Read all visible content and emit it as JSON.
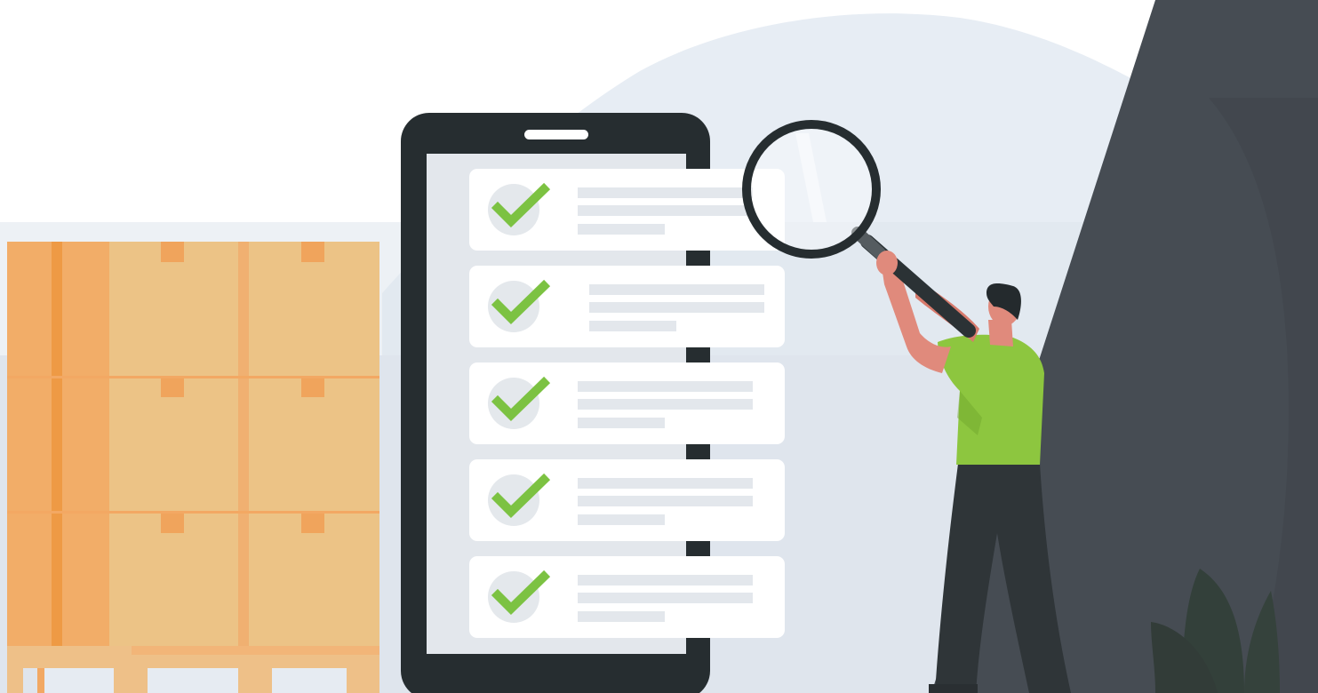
{
  "colors": {
    "background": "#ffffff",
    "backdrop_blob": "#e7edf4",
    "backdrop_band": "#dfe5ed",
    "box_light": "#ecc386",
    "box_mid": "#f2ad68",
    "box_dark": "#ee9a45",
    "box_tape": "#f0a45c",
    "pallet": "#eec088",
    "phone_frame": "#262d30",
    "phone_screen": "#e3e7ec",
    "card": "#ffffff",
    "check_circle": "#e4e8ec",
    "check_mark": "#7cc242",
    "text_line": "#e3e7ec",
    "person_shirt": "#8dc63f",
    "person_skin": "#e08a7c",
    "person_dark": "#2f3538",
    "wall": "#464c53",
    "plant": "#33403a"
  },
  "checklist": {
    "item_count": 5,
    "items": [
      {
        "checked": true,
        "icon": "check-icon"
      },
      {
        "checked": true,
        "icon": "check-icon"
      },
      {
        "checked": true,
        "icon": "check-icon"
      },
      {
        "checked": true,
        "icon": "check-icon"
      },
      {
        "checked": true,
        "icon": "check-icon"
      }
    ]
  },
  "icons": {
    "magnifier": "magnifying-glass-icon",
    "check": "check-icon"
  }
}
